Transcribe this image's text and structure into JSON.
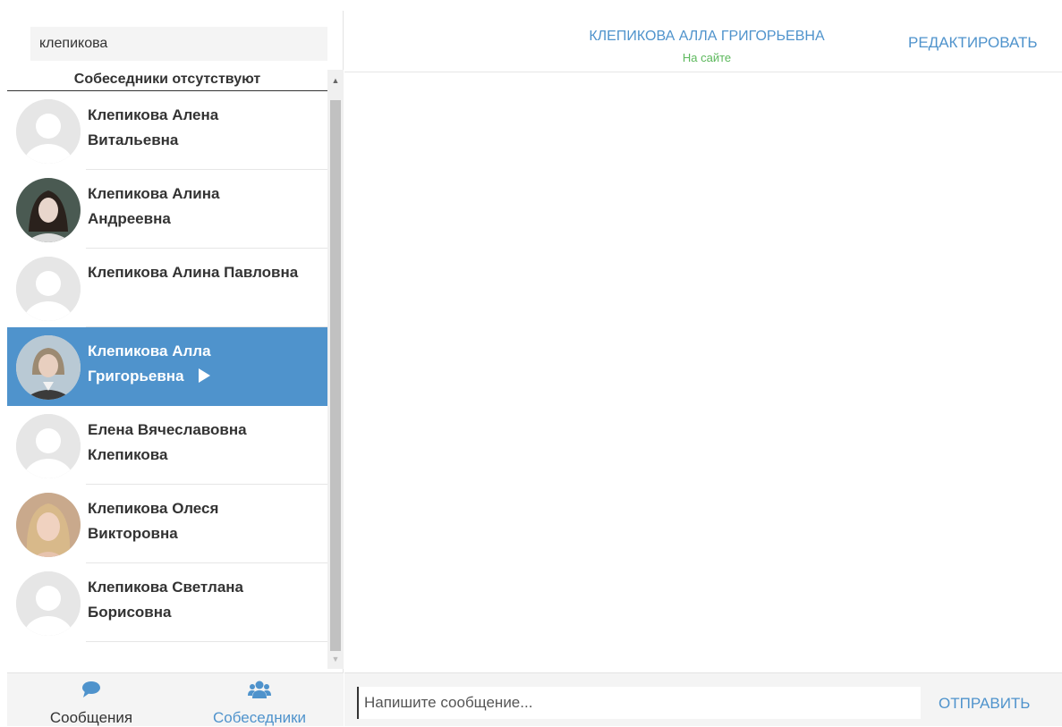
{
  "colors": {
    "accent": "#4f93cc",
    "online": "#5cb85c",
    "active_item_bg": "#4f93cc",
    "placeholder_avatar": "#e6e6e6"
  },
  "sidebar": {
    "search_value": "клепикова",
    "no_contacts_label": "Собеседники отсутствуют",
    "contacts": [
      {
        "line1": "Клепикова Алена",
        "line2": "Витальевна",
        "avatar": "placeholder-avatar",
        "active": false
      },
      {
        "line1": "Клепикова Алина",
        "line2": "Андреевна",
        "avatar": "photo-avatar",
        "active": false
      },
      {
        "line1": "Клепикова Алина Павловна",
        "line2": "",
        "avatar": "placeholder-avatar",
        "active": false
      },
      {
        "line1": "Клепикова Алла",
        "line2": "Григорьевна",
        "avatar": "photo-avatar",
        "active": true
      },
      {
        "line1": "Елена Вячеславовна",
        "line2": "Клепикова",
        "avatar": "placeholder-avatar",
        "active": false
      },
      {
        "line1": "Клепикова Олеся",
        "line2": "Викторовна",
        "avatar": "photo-avatar",
        "active": false
      },
      {
        "line1": "Клепикова Светлана",
        "line2": "Борисовна",
        "avatar": "placeholder-avatar",
        "active": false
      }
    ]
  },
  "bottom_nav": {
    "messages_label": "Сообщения",
    "messages_icon": "speech-bubble-icon",
    "contacts_label": "Собеседники",
    "contacts_icon": "users-icon"
  },
  "chat": {
    "contact_name": "КЛЕПИКОВА АЛЛА ГРИГОРЬЕВНА",
    "status": "На сайте",
    "edit_label": "РЕДАКТИРОВАТЬ",
    "message_placeholder": "Напишите сообщение...",
    "send_label": "ОТПРАВИТЬ"
  }
}
